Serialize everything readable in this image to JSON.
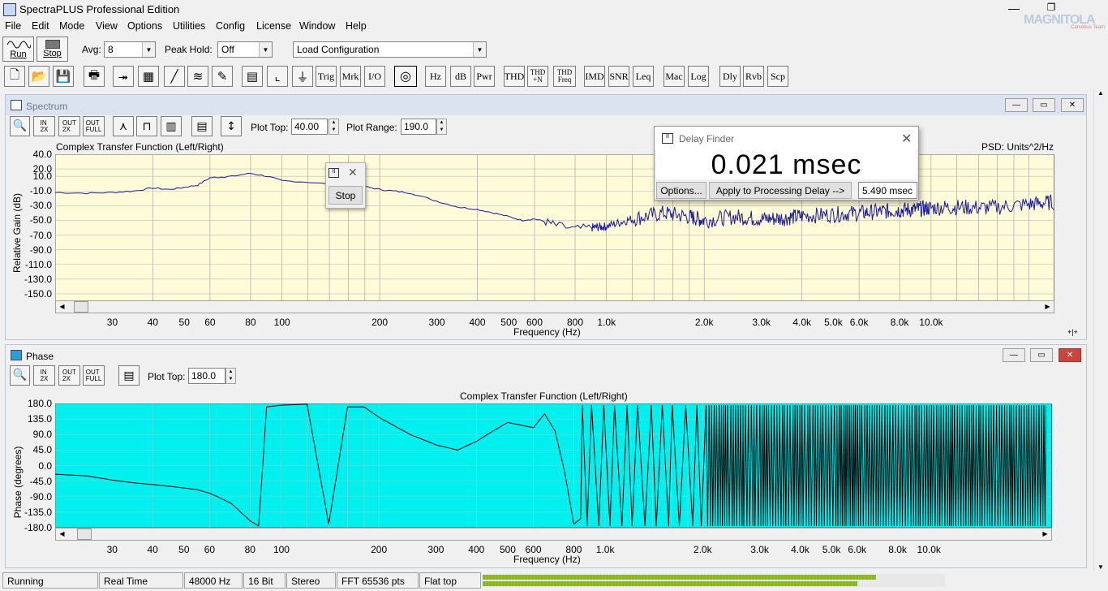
{
  "app": {
    "title": "SpectraPLUS Professional Edition",
    "logo_text": "MAGNITOLA",
    "logo_sub": "Camebus Team"
  },
  "menu": [
    "File",
    "Edit",
    "Mode",
    "View",
    "Options",
    "Utilities",
    "Config",
    "License",
    "Window",
    "Help"
  ],
  "toolbar1": {
    "run": "Run",
    "stop": "Stop",
    "avg_label": "Avg:",
    "avg_value": "8",
    "peak_label": "Peak Hold:",
    "peak_value": "Off",
    "config_value": "Load Configuration"
  },
  "toolbar2": {
    "text_buttons": [
      "Trig",
      "Mrk",
      "I/O",
      "Hz",
      "dB",
      "Pwr",
      "THD",
      "THD\n+N",
      "THD\nFreq",
      "IMD",
      "SNR",
      "Leq",
      "Mac",
      "Log",
      "Dly",
      "Rvb",
      "Scp"
    ],
    "icons": [
      "new-file-icon",
      "open-folder-icon",
      "save-icon",
      "print-icon",
      "recorder-icon",
      "analyzer-icon",
      "generator-icon",
      "spectrogram-icon",
      "report-icon",
      "overlay-icon",
      "chart-icon",
      "bell-icon",
      "sine-wave-icon"
    ]
  },
  "spectrum": {
    "title": "Spectrum",
    "plot_top_label": "Plot Top:",
    "plot_top": "40.00",
    "plot_range_label": "Plot Range:",
    "plot_range": "190.0",
    "chart_title": "Complex Transfer Function (Left/Right)",
    "psd_label": "PSD: Units^2/Hz",
    "ylabel": "Relative Gain (dB)",
    "xlabel": "Frequency (Hz)",
    "zoom_buttons": [
      "IN\n2X",
      "OUT\n2X",
      "OUT\nFULL"
    ],
    "corner": "+|+"
  },
  "phase": {
    "title": "Phase",
    "plot_top_label": "Plot Top:",
    "plot_top": "180.0",
    "chart_title": "Complex Transfer Function (Left/Right)",
    "ylabel": "Phase (degrees)",
    "xlabel": "Frequency (Hz)",
    "zoom_buttons": [
      "IN\n2X",
      "OUT\n2X",
      "OUT\nFULL"
    ]
  },
  "stop_popup": {
    "button": "Stop"
  },
  "delay_finder": {
    "title": "Delay Finder",
    "value": "0.021 msec",
    "options": "Options...",
    "apply": "Apply to Processing Delay -->",
    "result": "5.490 msec"
  },
  "status": {
    "cells": [
      "Running",
      "Real Time",
      "48000 Hz",
      "16 Bit",
      "Stereo",
      "FFT 65536 pts",
      "Flat top"
    ],
    "level_left": 0.85,
    "level_right": 0.81
  },
  "chart_data": [
    {
      "type": "line",
      "title": "Complex Transfer Function (Left/Right)",
      "xlabel": "Frequency (Hz)",
      "ylabel": "Relative Gain (dB)",
      "x_scale": "log",
      "xlim": [
        20,
        24000
      ],
      "ylim": [
        -160,
        40
      ],
      "yticks": [
        "40.0",
        "20.0",
        "10.0",
        "-10.0",
        "-30.0",
        "-50.0",
        "-70.0",
        "-90.0",
        "-110.0",
        "-130.0",
        "-150.0"
      ],
      "xticks": [
        "30",
        "40",
        "50",
        "60",
        "80",
        "100",
        "200",
        "300",
        "400",
        "500",
        "600",
        "800",
        "1.0k",
        "2.0k",
        "3.0k",
        "4.0k",
        "5.0k",
        "6.0k",
        "8.0k",
        "10.0k"
      ],
      "series": [
        {
          "x": [
            20,
            25,
            30,
            35,
            40,
            45,
            50,
            55,
            60,
            65,
            70,
            80,
            90,
            100,
            120,
            150,
            180,
            200,
            220,
            250,
            300,
            350,
            400,
            450,
            500,
            550,
            600,
            650,
            700,
            800,
            900,
            1000,
            1200,
            1500,
            1800,
            2000,
            2500,
            3000,
            3500,
            4000,
            5000,
            6000,
            7000,
            8000,
            9000,
            10000,
            12000,
            15000,
            20000,
            24000
          ],
          "y": [
            -12,
            -13,
            -12,
            -10,
            -6,
            -8,
            -5,
            -2,
            8,
            9,
            10,
            14,
            10,
            4,
            2,
            -2,
            -4,
            -8,
            -10,
            -13,
            -24,
            -32,
            -35,
            -40,
            -45,
            -50,
            -48,
            -52,
            -57,
            -62,
            -60,
            -58,
            -48,
            -40,
            -45,
            -50,
            -45,
            -48,
            -47,
            -44,
            -42,
            -40,
            -38,
            -36,
            -35,
            -33,
            -32,
            -33,
            -28,
            -25
          ]
        }
      ]
    },
    {
      "type": "line",
      "title": "Complex Transfer Function (Left/Right)",
      "xlabel": "Frequency (Hz)",
      "ylabel": "Phase (degrees)",
      "x_scale": "log",
      "xlim": [
        20,
        24000
      ],
      "ylim": [
        -180,
        180
      ],
      "yticks": [
        "180.0",
        "135.0",
        "90.0",
        "45.0",
        "0.0",
        "-45.0",
        "-90.0",
        "-135.0",
        "-180.0"
      ],
      "xticks": [
        "30",
        "40",
        "50",
        "60",
        "80",
        "100",
        "200",
        "300",
        "400",
        "500",
        "600",
        "800",
        "1.0k",
        "2.0k",
        "3.0k",
        "4.0k",
        "5.0k",
        "6.0k",
        "8.0k",
        "10.0k"
      ],
      "series": [
        {
          "x": [
            20,
            25,
            30,
            35,
            40,
            45,
            50,
            55,
            60,
            65,
            70,
            80,
            85,
            90,
            100,
            120,
            140,
            160,
            180,
            200,
            250,
            300,
            350,
            400,
            450,
            500,
            600,
            650,
            700,
            750,
            800,
            850
          ],
          "y": [
            -25,
            -30,
            -42,
            -50,
            -55,
            -60,
            -65,
            -70,
            -80,
            -95,
            -110,
            -160,
            -175,
            170,
            175,
            178,
            -170,
            170,
            170,
            140,
            90,
            60,
            45,
            70,
            100,
            125,
            110,
            150,
            100,
            -20,
            -170,
            -150
          ]
        }
      ]
    }
  ]
}
